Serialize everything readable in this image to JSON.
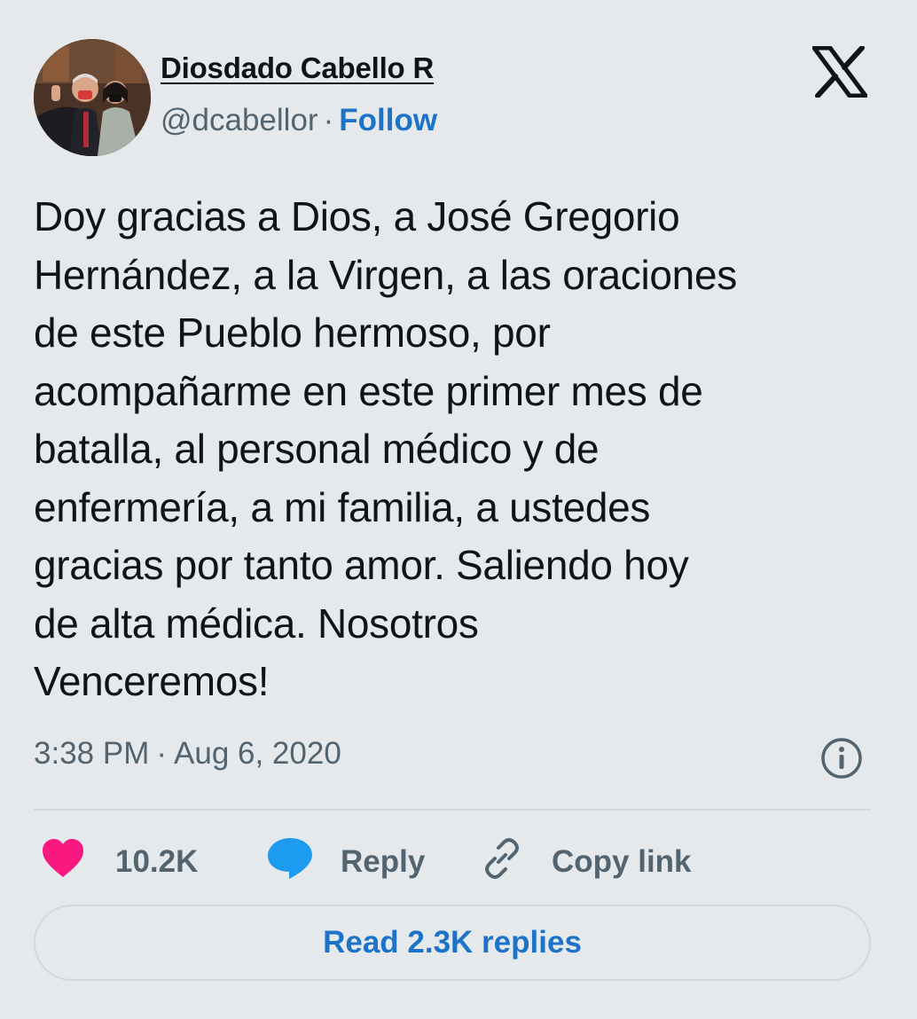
{
  "author": {
    "name": "Diosdado Cabello R",
    "handle": "@dcabellor",
    "separator": "·",
    "follow_label": "Follow"
  },
  "platform_icon": "x-logo-icon",
  "tweet": {
    "text": "Doy gracias a Dios, a José Gregorio\nHernández, a la Virgen, a las oraciones\nde este Pueblo hermoso, por\nacompañarme en este primer mes de\nbatalla, al personal médico y de\nenfermería, a mi familia, a ustedes\ngracias por tanto amor. Saliendo hoy\nde alta médica. Nosotros\nVenceremos!",
    "time": "3:38 PM",
    "separator": "·",
    "date": "Aug 6, 2020"
  },
  "actions": {
    "like_count": "10.2K",
    "reply_label": "Reply",
    "copy_link_label": "Copy link"
  },
  "read_replies_label": "Read 2.3K replies",
  "colors": {
    "background": "#e6e9ec",
    "link_blue": "#1d73c8",
    "heart_pink": "#f91880",
    "reply_blue": "#1d9bf0",
    "text_primary": "#0f1419",
    "text_secondary": "#536471"
  }
}
